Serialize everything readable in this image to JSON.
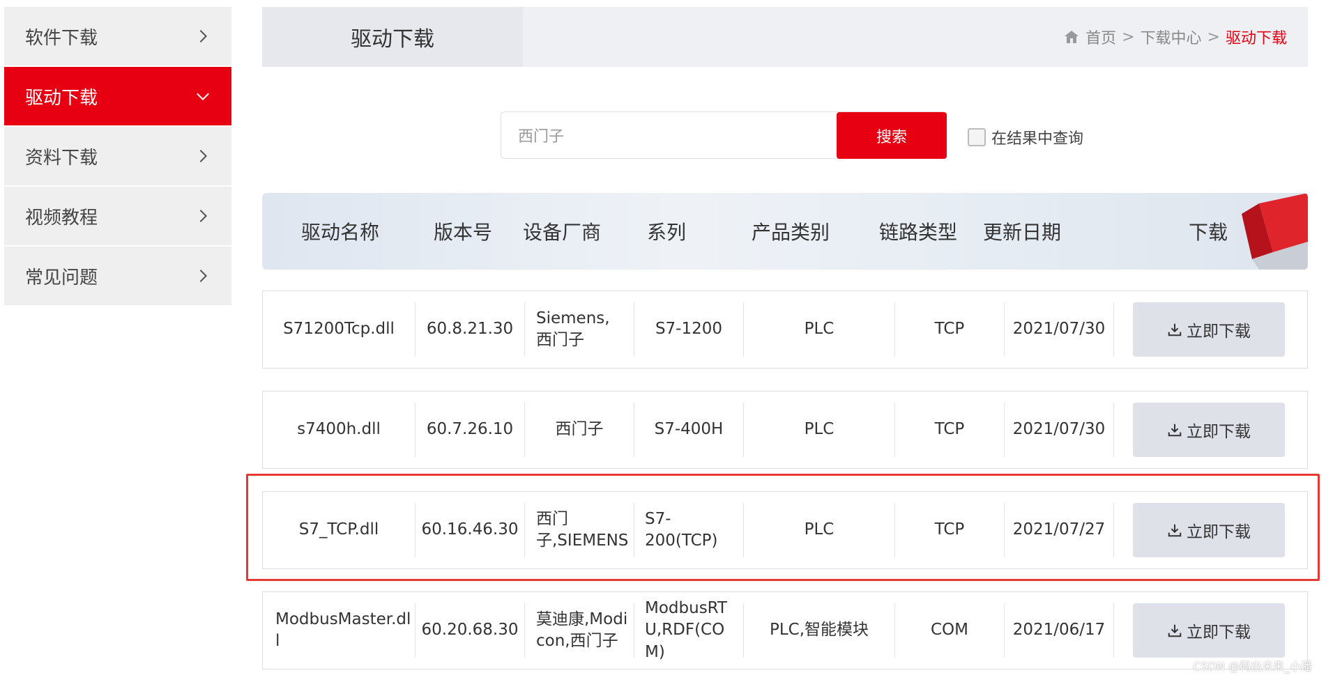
{
  "sidebar": {
    "items": [
      {
        "label": "软件下载",
        "active": false
      },
      {
        "label": "驱动下载",
        "active": true
      },
      {
        "label": "资料下载",
        "active": false
      },
      {
        "label": "视频教程",
        "active": false
      },
      {
        "label": "常见问题",
        "active": false
      }
    ]
  },
  "header": {
    "title": "驱动下载",
    "breadcrumb": [
      "首页",
      "下载中心",
      "驱动下载"
    ]
  },
  "search": {
    "value": "西门子",
    "button": "搜索",
    "filter_label": "在结果中查询"
  },
  "table": {
    "columns": [
      "驱动名称",
      "版本号",
      "设备厂商",
      "系列",
      "产品类别",
      "链路类型",
      "更新日期",
      "下载"
    ],
    "rows": [
      {
        "name": "S71200Tcp.dll",
        "version": "60.8.21.30",
        "vendor": "Siemens,西门子",
        "series": "S7-1200",
        "category": "PLC",
        "link": "TCP",
        "date": "2021/07/30",
        "download": "立即下载"
      },
      {
        "name": "s7400h.dll",
        "version": "60.7.26.10",
        "vendor": "西门子",
        "series": "S7-400H",
        "category": "PLC",
        "link": "TCP",
        "date": "2021/07/30",
        "download": "立即下载"
      },
      {
        "name": "S7_TCP.dll",
        "version": "60.16.46.30",
        "vendor": "西门子,SIEMENS",
        "series": "S7-200(TCP)",
        "category": "PLC",
        "link": "TCP",
        "date": "2021/07/27",
        "download": "立即下载"
      },
      {
        "name": "ModbusMaster.dll",
        "version": "60.20.68.30",
        "vendor": "莫迪康,Modicon,西门子",
        "series": "ModbusRTU,RDF(COM)",
        "category": "PLC,智能模块",
        "link": "COM",
        "date": "2021/06/17",
        "download": "立即下载"
      }
    ]
  },
  "watermark": "CSDN @码出未来_小潘",
  "colors": {
    "accent": "#e60012",
    "highlight": "#e53935"
  }
}
